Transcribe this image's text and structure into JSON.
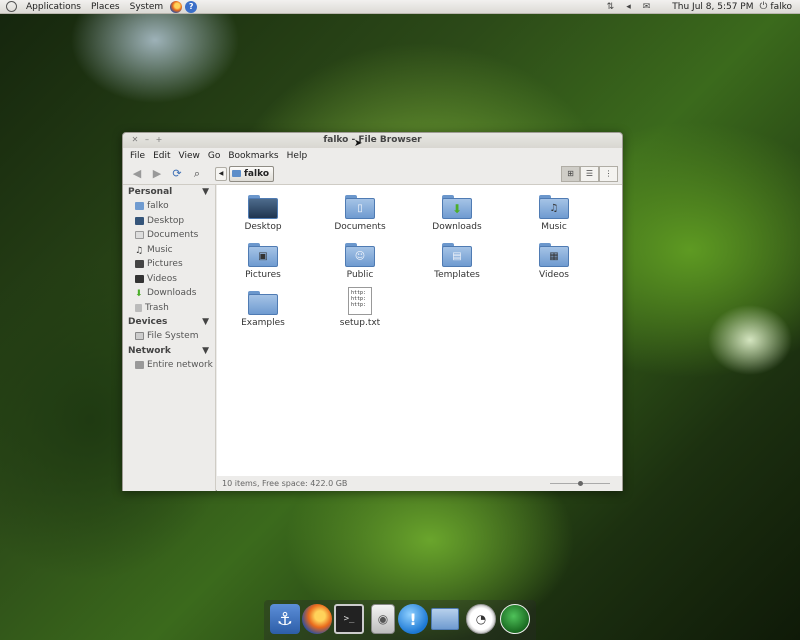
{
  "top_panel": {
    "menus": [
      "Applications",
      "Places",
      "System"
    ],
    "clock": "Thu Jul  8,  5:57 PM",
    "user": "falko"
  },
  "window": {
    "title": "falko - File Browser",
    "menu": [
      "File",
      "Edit",
      "View",
      "Go",
      "Bookmarks",
      "Help"
    ],
    "path_current": "falko",
    "sidebar": {
      "personal_header": "Personal",
      "personal_items": [
        "falko",
        "Desktop",
        "Documents",
        "Music",
        "Pictures",
        "Videos",
        "Downloads",
        "Trash"
      ],
      "devices_header": "Devices",
      "devices_items": [
        "File System"
      ],
      "network_header": "Network",
      "network_items": [
        "Entire network"
      ]
    },
    "items": [
      "Desktop",
      "Documents",
      "Downloads",
      "Music",
      "Pictures",
      "Public",
      "Templates",
      "Videos",
      "Examples",
      "setup.txt"
    ],
    "textfile_preview": "http:\nhttp:\nhttp:",
    "status": "10 items, Free space: 422.0 GB"
  },
  "colors": {
    "folder_blue": "#6f9bd0",
    "panel_bg": "#dcdad5",
    "window_bg": "#edecea"
  }
}
